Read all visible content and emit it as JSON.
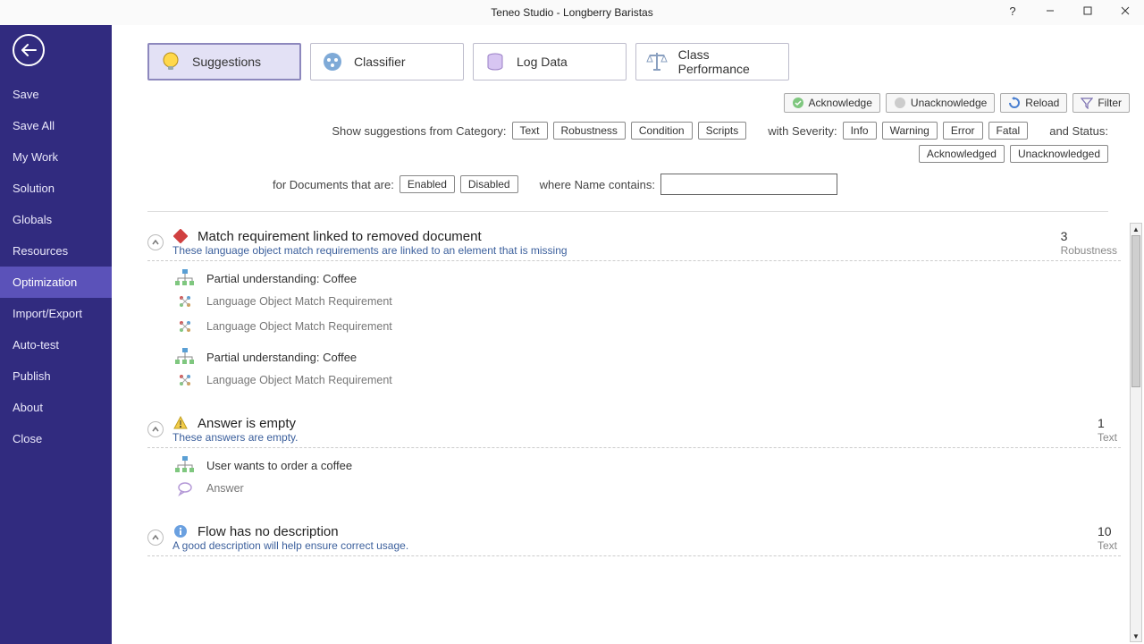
{
  "window": {
    "title": "Teneo Studio - Longberry Baristas"
  },
  "sidebar": {
    "items": [
      "Save",
      "Save All",
      "My Work",
      "Solution",
      "Globals",
      "Resources",
      "Optimization",
      "Import/Export",
      "Auto-test",
      "Publish",
      "About",
      "Close"
    ],
    "activeIndex": 6
  },
  "tabs": [
    {
      "label": "Suggestions"
    },
    {
      "label": "Classifier"
    },
    {
      "label": "Log Data"
    },
    {
      "label": "Class Performance"
    }
  ],
  "toolbar": {
    "acknowledge": "Acknowledge",
    "unacknowledge": "Unacknowledge",
    "reload": "Reload",
    "filter": "Filter"
  },
  "filters": {
    "categoryLabel": "Show suggestions from Category:",
    "categories": [
      "Text",
      "Robustness",
      "Condition",
      "Scripts"
    ],
    "severityLabel": "with Severity:",
    "severities": [
      "Info",
      "Warning",
      "Error",
      "Fatal"
    ],
    "statusLabel": "and Status:",
    "statuses": [
      "Acknowledged",
      "Unacknowledged"
    ],
    "docLabel": "for Documents that are:",
    "docStates": [
      "Enabled",
      "Disabled"
    ],
    "nameLabel": "where Name contains:",
    "nameValue": ""
  },
  "groups": [
    {
      "title": "Match requirement linked to removed document",
      "desc": "These language object match requirements are linked to an element that is missing",
      "count": "3",
      "category": "Robustness",
      "icon": "error",
      "items": [
        {
          "title": "Partial understanding: Coffee",
          "subs": [
            "Language Object Match Requirement",
            "Language Object Match Requirement"
          ]
        },
        {
          "title": "Partial understanding: Coffee",
          "subs": [
            "Language Object Match Requirement"
          ]
        }
      ]
    },
    {
      "title": "Answer is empty",
      "desc": "These answers are empty.",
      "count": "1",
      "category": "Text",
      "icon": "warning",
      "items": [
        {
          "title": "User wants to order a coffee",
          "subs": [
            "Answer"
          ],
          "subIcon": "bubble"
        }
      ]
    },
    {
      "title": "Flow has no description",
      "desc": "A good description will help ensure correct usage.",
      "count": "10",
      "category": "Text",
      "icon": "info",
      "items": []
    }
  ]
}
